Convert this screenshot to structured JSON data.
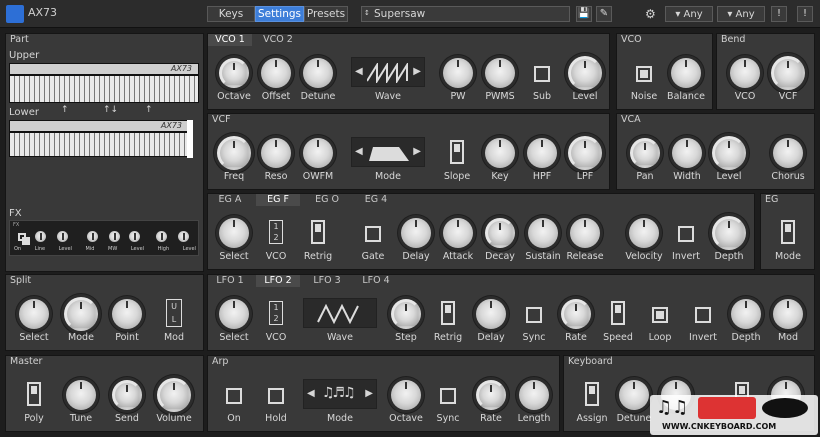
{
  "app": {
    "title": "AX73"
  },
  "topbar": {
    "tabs": [
      "Keys",
      "Settings",
      "Presets"
    ],
    "active_tab": "Settings",
    "preset": "Supersaw",
    "any1": "Any",
    "any2": "Any",
    "excl": "!"
  },
  "part": {
    "title": "Part",
    "upper": "Upper",
    "lower": "Lower",
    "fx": "FX",
    "brand": "AX73",
    "fx_labels": [
      "On",
      "Line",
      "Level",
      "Mid",
      "MW",
      "Level",
      "High",
      "Level"
    ]
  },
  "vco": {
    "tabs": [
      "VCO 1",
      "VCO 2"
    ],
    "labels": [
      "Octave",
      "Offset",
      "Detune",
      "Wave",
      "PW",
      "PWMS",
      "Sub",
      "Level"
    ]
  },
  "vco_side": {
    "title": "VCO",
    "labels": [
      "Noise",
      "Balance"
    ]
  },
  "bend": {
    "title": "Bend",
    "labels": [
      "VCO",
      "VCF"
    ]
  },
  "vcf": {
    "title": "VCF",
    "labels": [
      "Freq",
      "Reso",
      "OWFM",
      "Mode",
      "Slope",
      "Key",
      "HPF",
      "LPF"
    ]
  },
  "vca": {
    "title": "VCA",
    "labels": [
      "Pan",
      "Width",
      "Level",
      "Chorus"
    ]
  },
  "eg": {
    "tabs": [
      "EG A",
      "EG F",
      "EG O",
      "EG 4"
    ],
    "labels": [
      "Select",
      "VCO",
      "Retrig",
      "Gate",
      "Delay",
      "Attack",
      "Decay",
      "Sustain",
      "Release",
      "Velocity",
      "Invert",
      "Depth"
    ]
  },
  "eg_side": {
    "title": "EG",
    "labels": [
      "Mode"
    ]
  },
  "split": {
    "title": "Split",
    "labels": [
      "Select",
      "Mode",
      "Point",
      "Mod"
    ]
  },
  "lfo": {
    "tabs": [
      "LFO 1",
      "LFO 2",
      "LFO 3",
      "LFO 4"
    ],
    "labels": [
      "Select",
      "VCO",
      "Wave",
      "Step",
      "Retrig",
      "Delay",
      "Sync",
      "Rate",
      "Speed",
      "Loop",
      "Invert",
      "Depth",
      "Mod"
    ]
  },
  "master": {
    "title": "Master",
    "labels": [
      "Poly",
      "Tune",
      "Send",
      "Volume"
    ]
  },
  "arp": {
    "title": "Arp",
    "labels": [
      "On",
      "Hold",
      "Mode",
      "Octave",
      "Sync",
      "Rate",
      "Length"
    ]
  },
  "keyboard": {
    "title": "Keyboard",
    "labels": [
      "Assign",
      "Detune"
    ]
  },
  "watermark": {
    "text": "WWW.CNKEYBOARD.COM"
  }
}
